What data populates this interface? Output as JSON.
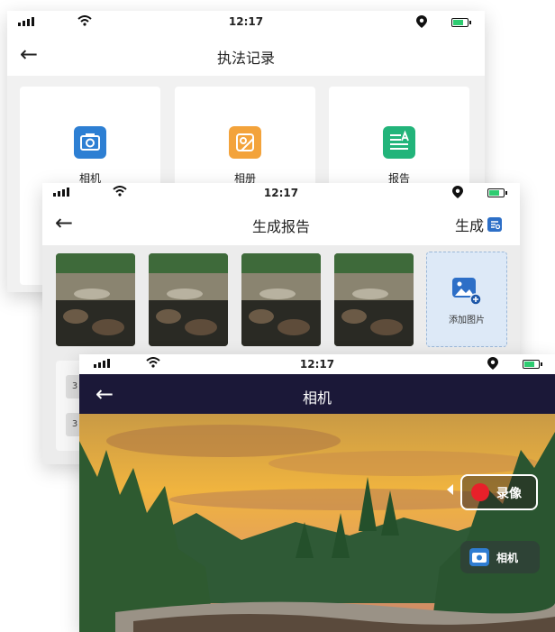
{
  "status": {
    "time": "12:17"
  },
  "card1": {
    "title": "执法记录",
    "tiles": [
      {
        "label": "相机",
        "color": "#2d7fd3"
      },
      {
        "label": "相册",
        "color": "#f3a33b"
      },
      {
        "label": "报告",
        "color": "#22b47a"
      }
    ]
  },
  "card2": {
    "title": "生成报告",
    "generate_label": "生成",
    "add_photo_label": "添加图片",
    "photo_count": 4,
    "row_tags": [
      "3",
      "3"
    ]
  },
  "card3": {
    "title": "相机",
    "record_label": "录像",
    "camera_label": "相机"
  },
  "colors": {
    "accent": "#2d7fd3",
    "record": "#e8202a",
    "dark_nav": "#1b1838"
  }
}
